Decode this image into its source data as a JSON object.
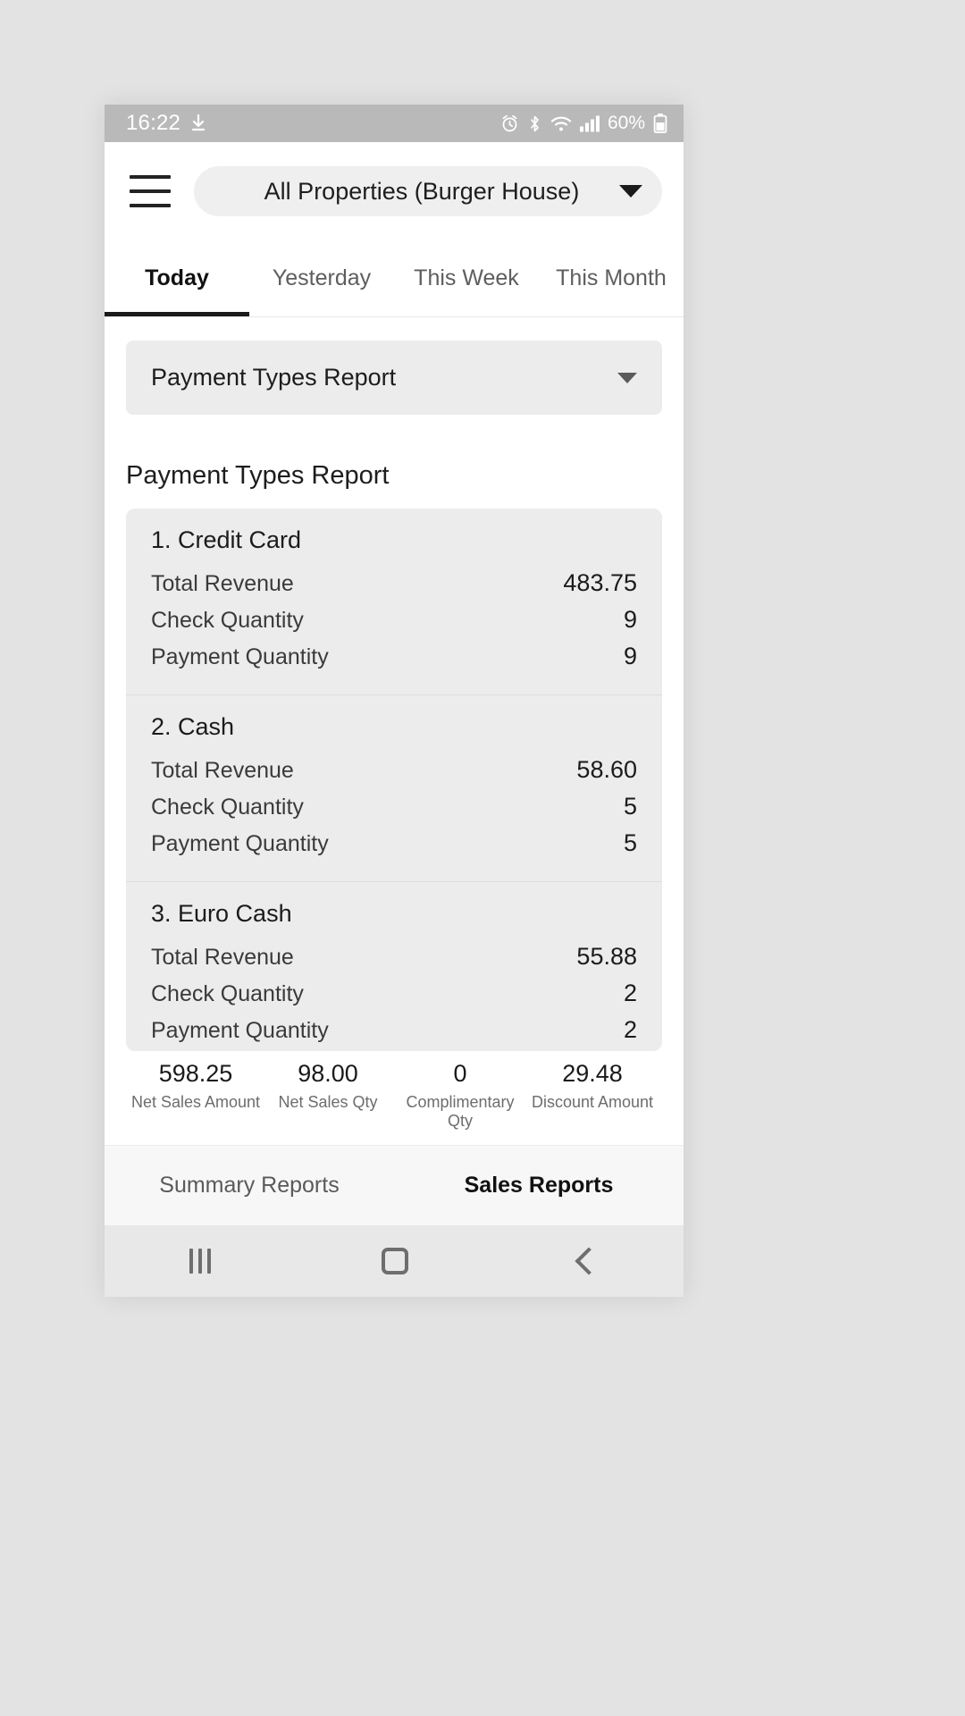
{
  "status_bar": {
    "time": "16:22",
    "download_icon": "download-icon",
    "alarm_icon": "alarm-icon",
    "bluetooth_icon": "bluetooth-icon",
    "wifi_icon": "wifi-icon",
    "signal_icon": "signal-bars-icon",
    "battery_percent": "60%",
    "battery_icon": "battery-icon"
  },
  "app_bar": {
    "menu_icon": "hamburger-menu-icon",
    "property_selector": "All Properties (Burger House)",
    "dropdown_icon": "chevron-down-icon"
  },
  "tabs": [
    {
      "label": "Today",
      "active": true
    },
    {
      "label": "Yesterday",
      "active": false
    },
    {
      "label": "This Week",
      "active": false
    },
    {
      "label": "This Month",
      "active": false
    }
  ],
  "report_selector": {
    "value": "Payment Types Report",
    "dropdown_icon": "chevron-down-icon"
  },
  "section_title": "Payment Types Report",
  "row_labels": {
    "total_revenue": "Total Revenue",
    "check_quantity": "Check Quantity",
    "payment_quantity": "Payment Quantity"
  },
  "payment_types": [
    {
      "title": "1. Credit Card",
      "total_revenue": "483.75",
      "check_quantity": "9",
      "payment_quantity": "9"
    },
    {
      "title": "2. Cash",
      "total_revenue": "58.60",
      "check_quantity": "5",
      "payment_quantity": "5"
    },
    {
      "title": "3. Euro Cash",
      "total_revenue": "55.88",
      "check_quantity": "2",
      "payment_quantity": "2"
    }
  ],
  "summary": [
    {
      "value": "598.25",
      "label": "Net Sales Amount"
    },
    {
      "value": "98.00",
      "label": "Net Sales Qty"
    },
    {
      "value": "0",
      "label": "Complimentary Qty"
    },
    {
      "value": "29.48",
      "label": "Discount Amount"
    }
  ],
  "bottom_tabs": [
    {
      "label": "Summary Reports",
      "active": false
    },
    {
      "label": "Sales Reports",
      "active": true
    }
  ],
  "nav_bar": {
    "recents_icon": "recents-icon",
    "home_icon": "home-icon",
    "back_icon": "back-icon"
  },
  "colors": {
    "accent": "#1a1a1a",
    "card_bg": "#ececec",
    "status_bar_bg": "#b9b9b9",
    "page_bg": "#e3e3e3"
  }
}
